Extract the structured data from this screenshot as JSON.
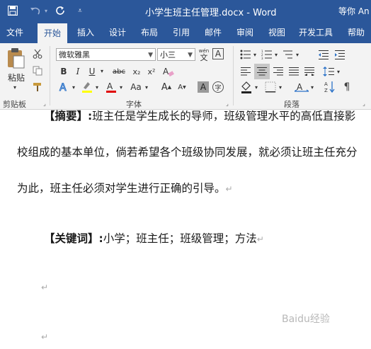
{
  "titlebar": {
    "title": "小学生班主任管理.docx  -  Word",
    "user": "等你 An",
    "bg": "#2b579a"
  },
  "tabs": [
    {
      "label": "文件",
      "active": false
    },
    {
      "label": "开始",
      "active": true
    },
    {
      "label": "插入",
      "active": false
    },
    {
      "label": "设计",
      "active": false
    },
    {
      "label": "布局",
      "active": false
    },
    {
      "label": "引用",
      "active": false
    },
    {
      "label": "邮件",
      "active": false
    },
    {
      "label": "审阅",
      "active": false
    },
    {
      "label": "视图",
      "active": false
    },
    {
      "label": "开发工具",
      "active": false
    },
    {
      "label": "帮助",
      "active": false
    }
  ],
  "ribbon": {
    "clipboard": {
      "paste_label": "粘贴",
      "group_label": "剪贴板"
    },
    "font": {
      "font_name": "微软雅黑",
      "font_size": "小三",
      "wen_glyph": "wén",
      "wen_char": "文",
      "a_box": "A",
      "bold": "B",
      "italic": "I",
      "underline": "U",
      "strike": "abc",
      "subscript": "x₂",
      "superscript": "x²",
      "case": "Aa",
      "grow": "A",
      "shrink": "A",
      "shade_char": "A",
      "enclose_char": "字",
      "group_label": "字体"
    },
    "paragraph": {
      "group_label": "段落"
    }
  },
  "document": {
    "line1_bold": "【摘要】:",
    "line1_text": "班主任是学生成长的导师，班级管理水平的高低直接影",
    "line2": "校组成的基本单位，倘若希望各个班级协同发展，就必须让班主任充分",
    "line3": "为此，班主任必须对学生进行正确的引导。",
    "keywords_bold": "【关键词】:",
    "keywords_text": "小学；班主任；班级管理；方法",
    "para_mark": "↵"
  },
  "watermark": "Baidu经验"
}
